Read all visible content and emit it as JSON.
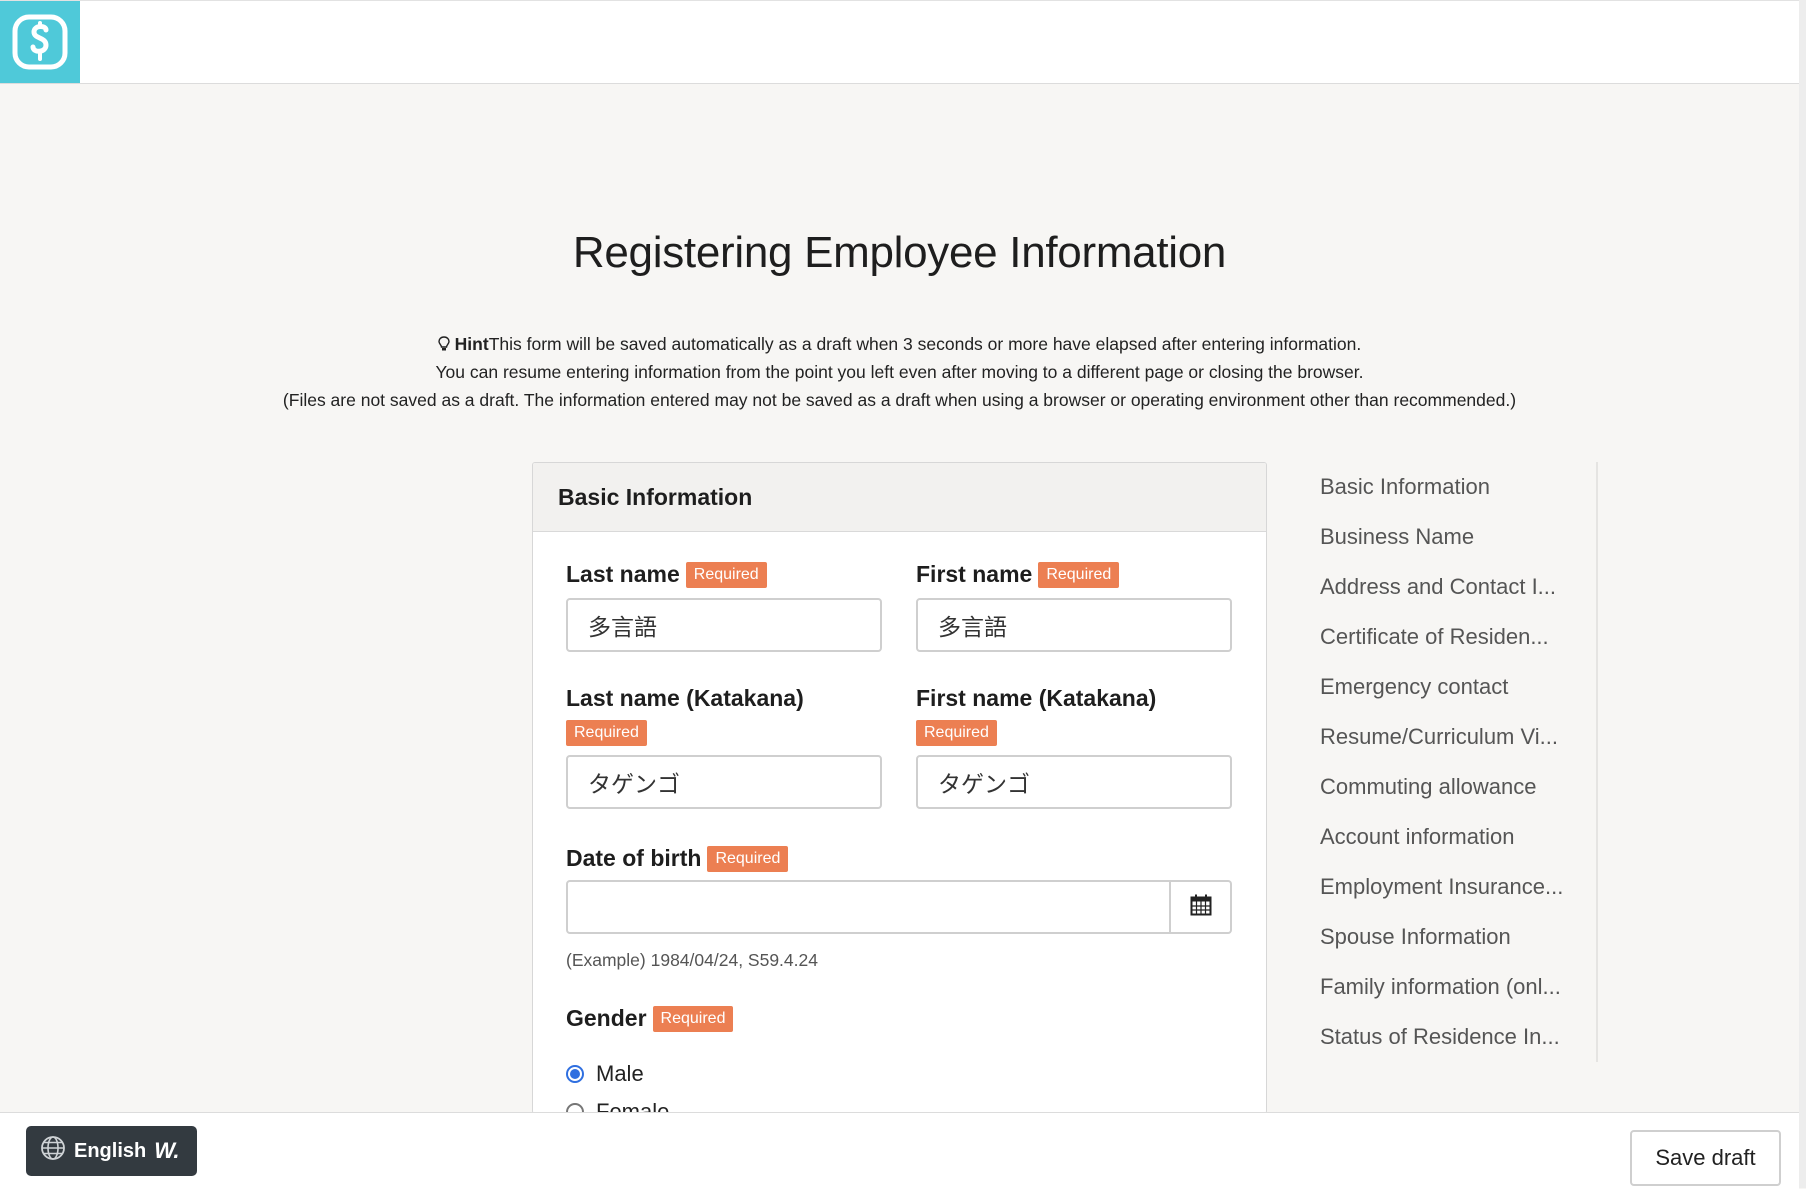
{
  "colors": {
    "accent": "#4fc9d9",
    "required_badge": "#ec7f52",
    "radio_selected": "#2f6fe0"
  },
  "header": {
    "logo_icon": "s-logo-icon"
  },
  "page": {
    "title": "Registering Employee Information",
    "hint_label": "Hint",
    "hint_icon": "lightbulb-icon",
    "hint_line1": "This form will be saved automatically as a draft when 3 seconds or more have elapsed after entering information.",
    "hint_line2": "You can resume entering information from the point you left even after moving to a different page or closing the browser.",
    "hint_line3": "(Files are not saved as a draft. The information entered may not be saved as a draft when using a browser or operating environment other than recommended.)"
  },
  "form": {
    "section_title": "Basic Information",
    "required": "Required",
    "last_name": {
      "label": "Last name",
      "value": "多言語"
    },
    "first_name": {
      "label": "First name",
      "value": "多言語"
    },
    "last_name_kana": {
      "label": "Last name (Katakana)",
      "value": "タゲンゴ"
    },
    "first_name_kana": {
      "label": "First name (Katakana)",
      "value": "タゲンゴ"
    },
    "dob": {
      "label": "Date of birth",
      "value": "",
      "example": "(Example) 1984/04/24, S59.4.24"
    },
    "gender": {
      "label": "Gender",
      "options": [
        "Male",
        "Female"
      ],
      "selected": "Male"
    }
  },
  "side_nav": {
    "items": [
      "Basic Information",
      "Business Name",
      "Address and Contact I...",
      "Certificate of Residen...",
      "Emergency contact",
      "Resume/Curriculum Vi...",
      "Commuting allowance",
      "Account information",
      "Employment Insurance...",
      "Spouse Information",
      "Family information (onl...",
      "Status of Residence In..."
    ]
  },
  "footer": {
    "language": "English",
    "language_icon": "globe-icon",
    "brand_mark": "W.",
    "save_draft": "Save draft"
  }
}
